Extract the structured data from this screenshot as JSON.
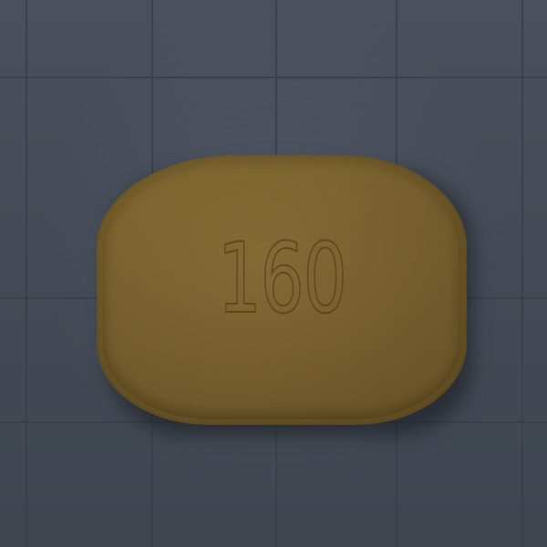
{
  "scene": {
    "background_color": "#454c57",
    "grid_color": "#3a404a"
  },
  "tablet": {
    "imprint": "160",
    "color": "#735c2c",
    "imprint_color": "#5b4318"
  }
}
